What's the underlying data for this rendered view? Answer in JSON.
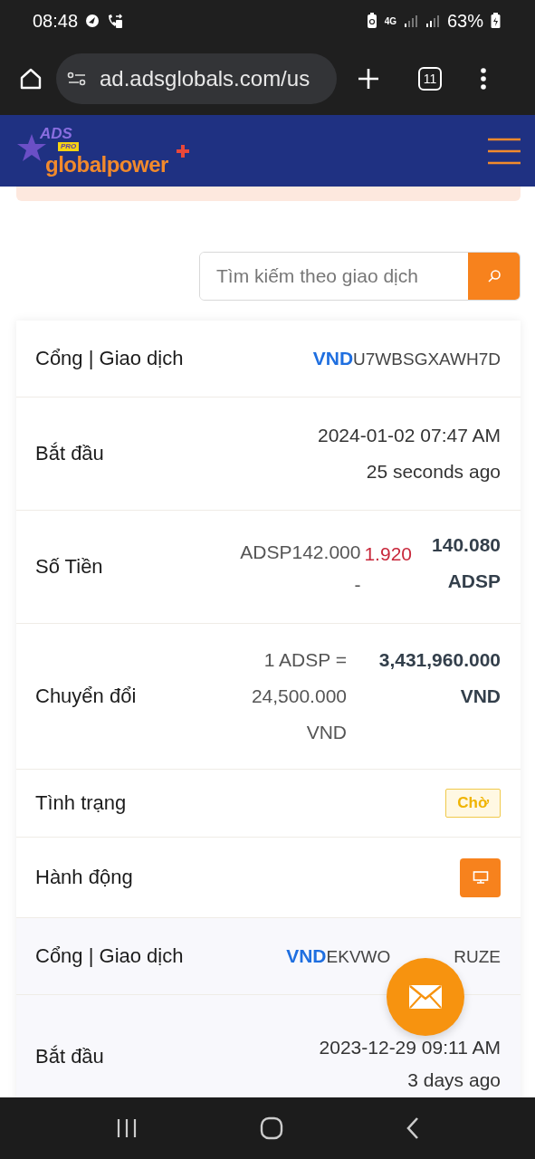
{
  "status_bar": {
    "time": "08:48",
    "network": "4G",
    "battery": "63%"
  },
  "browser": {
    "url": "ad.adsglobals.com/us",
    "tab_count": "11"
  },
  "site_header": {
    "logo_top": "ADS",
    "logo_badge": "PRO",
    "logo_main": "globalpower"
  },
  "search": {
    "placeholder": "Tìm kiếm theo giao dịch"
  },
  "transactions": [
    {
      "rows": [
        {
          "kind": "code",
          "label": "Cổng | Giao dịch",
          "currency": "VND",
          "code": "U7WBSGXAWH7D"
        },
        {
          "kind": "datetime",
          "label": "Bắt đầu",
          "date": "2024-01-02 07:47 AM",
          "relative": "25 seconds ago"
        },
        {
          "kind": "amount",
          "label": "Số Tiền",
          "gross": "ADSP142.000",
          "minus": "-",
          "fee": "1.920",
          "net": "140.080 ADSP"
        },
        {
          "kind": "conversion",
          "label": "Chuyển đổi",
          "rate": "1 ADSP = 24,500.000 VND",
          "total": "3,431,960.000 VND"
        },
        {
          "kind": "status",
          "label": "Tình trạng",
          "status": "Chờ"
        },
        {
          "kind": "action",
          "label": "Hành động"
        }
      ]
    },
    {
      "rows": [
        {
          "kind": "code",
          "label": "Cổng | Giao dịch",
          "currency": "VND",
          "code": "EKVWO",
          "code_end": "RUZE"
        },
        {
          "kind": "datetime",
          "label": "Bắt đầu",
          "date": "2023-12-29 09:11 AM",
          "relative": "3 days ago"
        }
      ]
    }
  ]
}
